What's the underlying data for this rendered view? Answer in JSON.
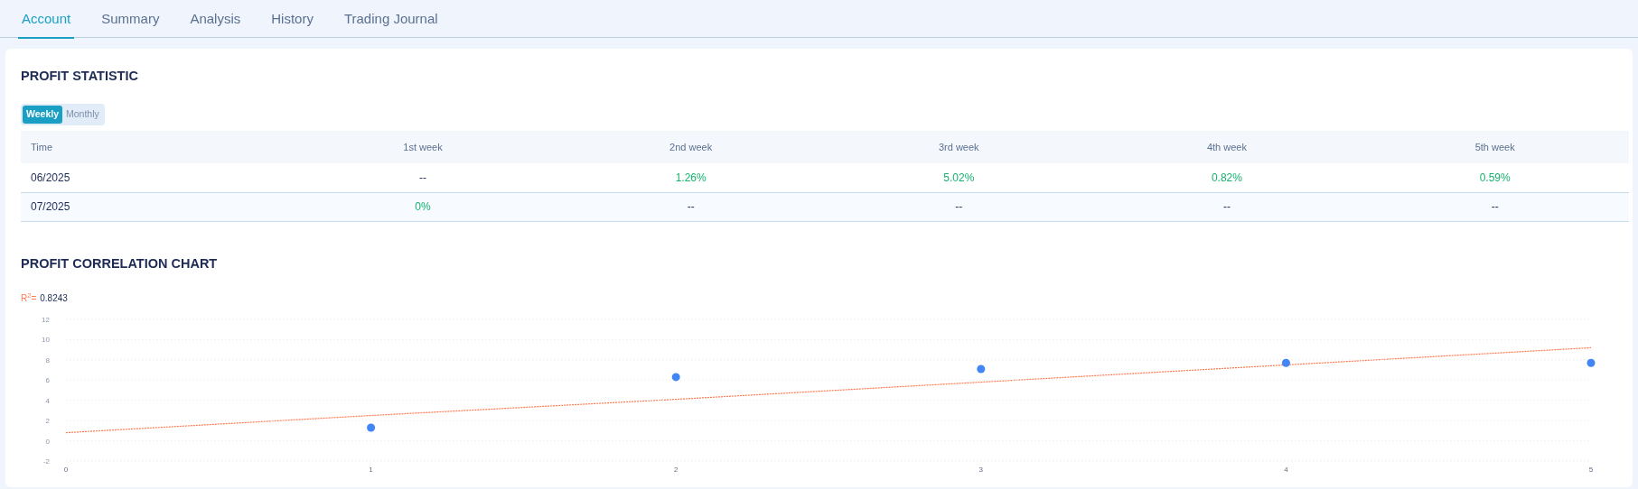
{
  "tabs": [
    {
      "label": "Account",
      "selected": true
    },
    {
      "label": "Summary",
      "selected": false
    },
    {
      "label": "Analysis",
      "selected": false
    },
    {
      "label": "History",
      "selected": false
    },
    {
      "label": "Trading Journal",
      "selected": false
    }
  ],
  "profit_statistic": {
    "title": "PROFIT STATISTIC",
    "period_toggle": [
      {
        "label": "Weekly",
        "selected": true
      },
      {
        "label": "Monthly",
        "selected": false
      }
    ],
    "table": {
      "columns": [
        "Time",
        "1st week",
        "2nd week",
        "3rd week",
        "4th week",
        "5th week"
      ],
      "rows": [
        {
          "cells": [
            "06/2025",
            "--",
            "1.26%",
            "5.02%",
            "0.82%",
            "0.59%"
          ]
        },
        {
          "cells": [
            "07/2025",
            "0%",
            "--",
            "--",
            "--",
            "--"
          ]
        }
      ]
    }
  },
  "profit_correlation_chart": {
    "title": "PROFIT CORRELATION CHART",
    "r_squared_label": "R$^{2}$=",
    "r_squared_value": "0.8243",
    "chart_data": {
      "type": "scatter",
      "x": [
        0,
        1,
        2,
        3,
        4,
        5
      ],
      "grid": true,
      "series": [
        {
          "color": "#4285f4",
          "values": [
            null,
            1.3,
            6.3,
            7.1,
            7.7,
            7.7
          ]
        },
        {
          "type": "line",
          "line_style": "dashed",
          "color": "#ff7a50",
          "values": [
            0.8,
            2.5,
            4.1,
            5.8,
            7.5,
            9.2
          ]
        }
      ],
      "xlim": [
        0,
        5
      ],
      "ylim": [
        -2,
        12
      ],
      "xticks": [
        0,
        1,
        2,
        3,
        4,
        5
      ],
      "yticks": [
        -2,
        0,
        2,
        4,
        6,
        8,
        10,
        12
      ]
    }
  }
}
